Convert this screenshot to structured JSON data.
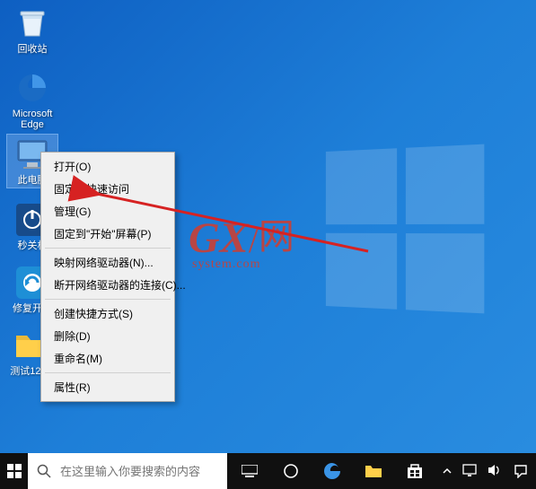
{
  "desktop": {
    "icons": {
      "recycle": {
        "label": "回收站"
      },
      "edge": {
        "label": "Microsoft Edge"
      },
      "this_pc": {
        "label": "此电脑"
      },
      "miaoguan": {
        "label": "秒关机"
      },
      "fix_boot": {
        "label": "修复开机"
      },
      "folder": {
        "label": "测试123..."
      }
    }
  },
  "context_menu": {
    "open": "打开(O)",
    "pin_quick": "固定到快速访问",
    "manage": "管理(G)",
    "pin_start": "固定到\"开始\"屏幕(P)",
    "map_drive": "映射网络驱动器(N)...",
    "disconnect_drive": "断开网络驱动器的连接(C)...",
    "create_shortcut": "创建快捷方式(S)",
    "delete": "删除(D)",
    "rename": "重命名(M)",
    "properties": "属性(R)"
  },
  "taskbar": {
    "search_placeholder": "在这里输入你要搜索的内容"
  },
  "watermark": {
    "brand_left": "GX",
    "brand_slash": "/",
    "brand_right": "网",
    "subtitle": "system.com",
    "full_left": "G"
  }
}
